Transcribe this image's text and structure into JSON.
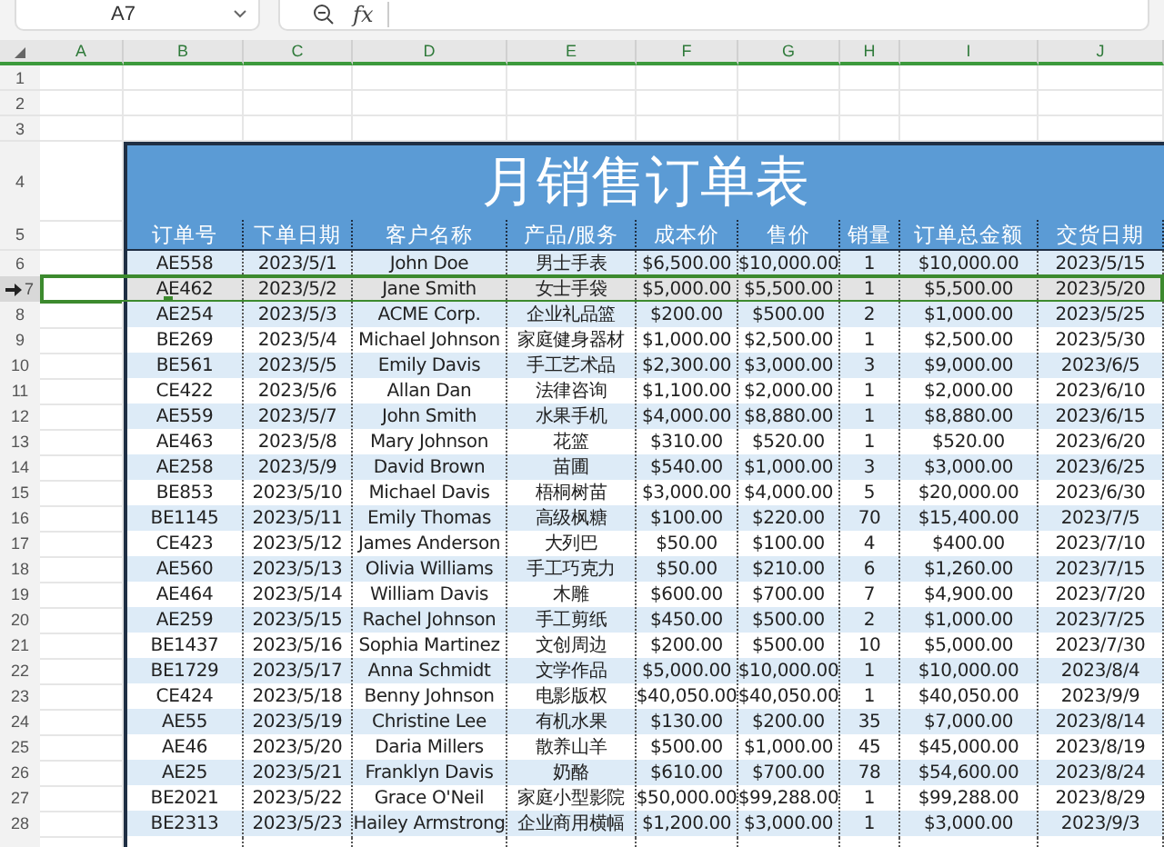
{
  "formula_bar": {
    "name_box": "A7",
    "fx": "fx"
  },
  "columns": [
    "A",
    "B",
    "C",
    "D",
    "E",
    "F",
    "G",
    "H",
    "I",
    "J"
  ],
  "empty_rows": [
    "1",
    "2",
    "3"
  ],
  "title_row": {
    "number": "4",
    "title": "月销售订单表"
  },
  "header_row": {
    "number": "5",
    "cells": [
      "订单号",
      "下单日期",
      "客户名称",
      "产品/服务",
      "成本价",
      "售价",
      "销量",
      "订单总金额",
      "交货日期"
    ]
  },
  "rows": [
    {
      "number": "6",
      "selected": false,
      "cells": [
        "AE558",
        "2023/5/1",
        "John Doe",
        "男士手表",
        "$6,500.00",
        "$10,000.00",
        "1",
        "$10,000.00",
        "2023/5/15"
      ]
    },
    {
      "number": "7",
      "selected": true,
      "cells": [
        "AE462",
        "2023/5/2",
        "Jane Smith",
        "女士手袋",
        "$5,000.00",
        "$5,500.00",
        "1",
        "$5,500.00",
        "2023/5/20"
      ]
    },
    {
      "number": "8",
      "selected": false,
      "cells": [
        "AE254",
        "2023/5/3",
        "ACME Corp.",
        "企业礼品篮",
        "$200.00",
        "$500.00",
        "2",
        "$1,000.00",
        "2023/5/25"
      ]
    },
    {
      "number": "9",
      "selected": false,
      "cells": [
        "BE269",
        "2023/5/4",
        "Michael Johnson",
        "家庭健身器材",
        "$1,000.00",
        "$2,500.00",
        "1",
        "$2,500.00",
        "2023/5/30"
      ]
    },
    {
      "number": "10",
      "selected": false,
      "cells": [
        "BE561",
        "2023/5/5",
        "Emily Davis",
        "手工艺术品",
        "$2,300.00",
        "$3,000.00",
        "3",
        "$9,000.00",
        "2023/6/5"
      ]
    },
    {
      "number": "11",
      "selected": false,
      "cells": [
        "CE422",
        "2023/5/6",
        "Allan Dan",
        "法律咨询",
        "$1,100.00",
        "$2,000.00",
        "1",
        "$2,000.00",
        "2023/6/10"
      ]
    },
    {
      "number": "12",
      "selected": false,
      "cells": [
        "AE559",
        "2023/5/7",
        "John Smith",
        "水果手机",
        "$4,000.00",
        "$8,880.00",
        "1",
        "$8,880.00",
        "2023/6/15"
      ]
    },
    {
      "number": "13",
      "selected": false,
      "cells": [
        "AE463",
        "2023/5/8",
        "Mary Johnson",
        "花篮",
        "$310.00",
        "$520.00",
        "1",
        "$520.00",
        "2023/6/20"
      ]
    },
    {
      "number": "14",
      "selected": false,
      "cells": [
        "AE258",
        "2023/5/9",
        "David Brown",
        "苗圃",
        "$540.00",
        "$1,000.00",
        "3",
        "$3,000.00",
        "2023/6/25"
      ]
    },
    {
      "number": "15",
      "selected": false,
      "cells": [
        "BE853",
        "2023/5/10",
        "Michael Davis",
        "梧桐树苗",
        "$3,000.00",
        "$4,000.00",
        "5",
        "$20,000.00",
        "2023/6/30"
      ]
    },
    {
      "number": "16",
      "selected": false,
      "cells": [
        "BE1145",
        "2023/5/11",
        "Emily Thomas",
        "高级枫糖",
        "$100.00",
        "$220.00",
        "70",
        "$15,400.00",
        "2023/7/5"
      ]
    },
    {
      "number": "17",
      "selected": false,
      "cells": [
        "CE423",
        "2023/5/12",
        "James Anderson",
        "大列巴",
        "$50.00",
        "$100.00",
        "4",
        "$400.00",
        "2023/7/10"
      ]
    },
    {
      "number": "18",
      "selected": false,
      "cells": [
        "AE560",
        "2023/5/13",
        "Olivia Williams",
        "手工巧克力",
        "$50.00",
        "$210.00",
        "6",
        "$1,260.00",
        "2023/7/15"
      ]
    },
    {
      "number": "19",
      "selected": false,
      "cells": [
        "AE464",
        "2023/5/14",
        "William Davis",
        "木雕",
        "$600.00",
        "$700.00",
        "7",
        "$4,900.00",
        "2023/7/20"
      ]
    },
    {
      "number": "20",
      "selected": false,
      "cells": [
        "AE259",
        "2023/5/15",
        "Rachel Johnson",
        "手工剪纸",
        "$450.00",
        "$500.00",
        "2",
        "$1,000.00",
        "2023/7/25"
      ]
    },
    {
      "number": "21",
      "selected": false,
      "cells": [
        "BE1437",
        "2023/5/16",
        "Sophia Martinez",
        "文创周边",
        "$200.00",
        "$500.00",
        "10",
        "$5,000.00",
        "2023/7/30"
      ]
    },
    {
      "number": "22",
      "selected": false,
      "cells": [
        "BE1729",
        "2023/5/17",
        "Anna Schmidt",
        "文学作品",
        "$5,000.00",
        "$10,000.00",
        "1",
        "$10,000.00",
        "2023/8/4"
      ]
    },
    {
      "number": "23",
      "selected": false,
      "cells": [
        "CE424",
        "2023/5/18",
        "Benny Johnson",
        "电影版权",
        "$40,050.00",
        "$40,050.00",
        "1",
        "$40,050.00",
        "2023/9/9"
      ]
    },
    {
      "number": "24",
      "selected": false,
      "cells": [
        "AE55",
        "2023/5/19",
        "Christine Lee",
        "有机水果",
        "$130.00",
        "$200.00",
        "35",
        "$7,000.00",
        "2023/8/14"
      ]
    },
    {
      "number": "25",
      "selected": false,
      "cells": [
        "AE46",
        "2023/5/20",
        "Daria Millers",
        "散养山羊",
        "$500.00",
        "$1,000.00",
        "45",
        "$45,000.00",
        "2023/8/19"
      ]
    },
    {
      "number": "26",
      "selected": false,
      "cells": [
        "AE25",
        "2023/5/21",
        "Franklyn Davis",
        "奶酪",
        "$610.00",
        "$700.00",
        "78",
        "$54,600.00",
        "2023/8/24"
      ]
    },
    {
      "number": "27",
      "selected": false,
      "cells": [
        "BE2021",
        "2023/5/22",
        "Grace O'Neil",
        "家庭小型影院",
        "$50,000.00",
        "$99,288.00",
        "1",
        "$99,288.00",
        "2023/8/29"
      ]
    },
    {
      "number": "28",
      "selected": false,
      "cells": [
        "BE2313",
        "2023/5/23",
        "Hailey Armstrong",
        "企业商用横幅",
        "$1,200.00",
        "$3,000.00",
        "1",
        "$3,000.00",
        "2023/9/3"
      ]
    }
  ]
}
